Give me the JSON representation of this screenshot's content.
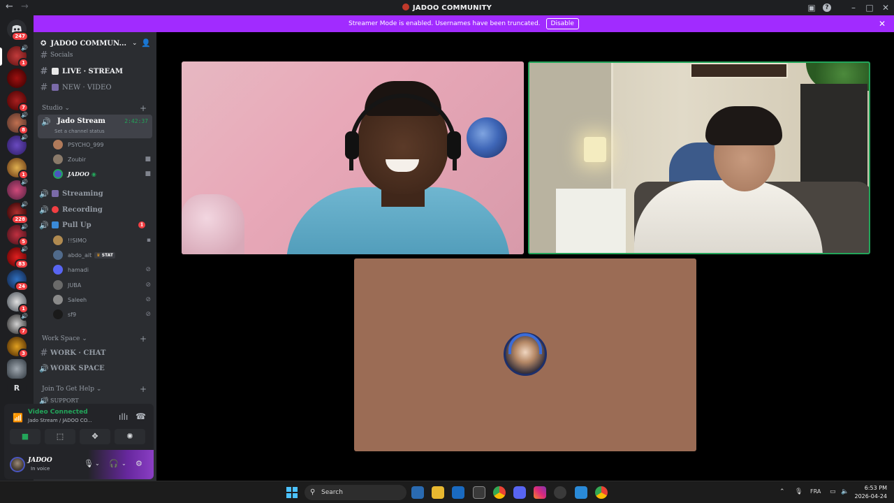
{
  "window": {
    "title": "JADOO COMMUNITY"
  },
  "banner": {
    "text": "Streamer Mode is enabled. Usernames have been truncated.",
    "button": "Disable"
  },
  "rail": {
    "top_badge": "247",
    "server_badges": [
      "1",
      "7",
      "8",
      "1",
      "228",
      "5",
      "83",
      "24",
      "1",
      "7",
      "3"
    ],
    "bottom_letter": "R"
  },
  "guild": {
    "name": "JADOO COMMUN..."
  },
  "channels": {
    "socials": "Socials",
    "live_stream": "LIVE · STREAM",
    "new_video": "NEW · VIDEO",
    "cat_studio": "Studio",
    "jado_stream": "Jado Stream",
    "jado_timer": "2:42:37",
    "set_status": "Set a channel status",
    "streaming": "Streaming",
    "recording": "Recording",
    "pull_up": "Pull Up",
    "pull_up_badge": "1",
    "cat_workspace": "Work Space",
    "work_chat": "WORK · CHAT",
    "work_space": "WORK SPACE",
    "cat_help": "Join To Get Help",
    "support": "SUPPORT"
  },
  "voice_users_stream": [
    "PSYCHO_999",
    "Zoubir",
    "JADOO"
  ],
  "voice_users_pullup": [
    "!!SIMO",
    "abdo_ait",
    "hamadi",
    "JUBA",
    "Saleeh",
    "sf9"
  ],
  "pullup_tag": "STAT",
  "voice_panel": {
    "status": "Video Connected",
    "location": "Jado Stream / JADOO CO..."
  },
  "user": {
    "name": "JADOO",
    "status": "In voice"
  },
  "taskbar": {
    "search": "Search",
    "lang": "FRA",
    "time": "6:53 PM",
    "date": "2026-04-24"
  },
  "colors": {
    "banner": "#a12bff",
    "speaking_border": "#23a55a",
    "badge": "#f23f43"
  }
}
